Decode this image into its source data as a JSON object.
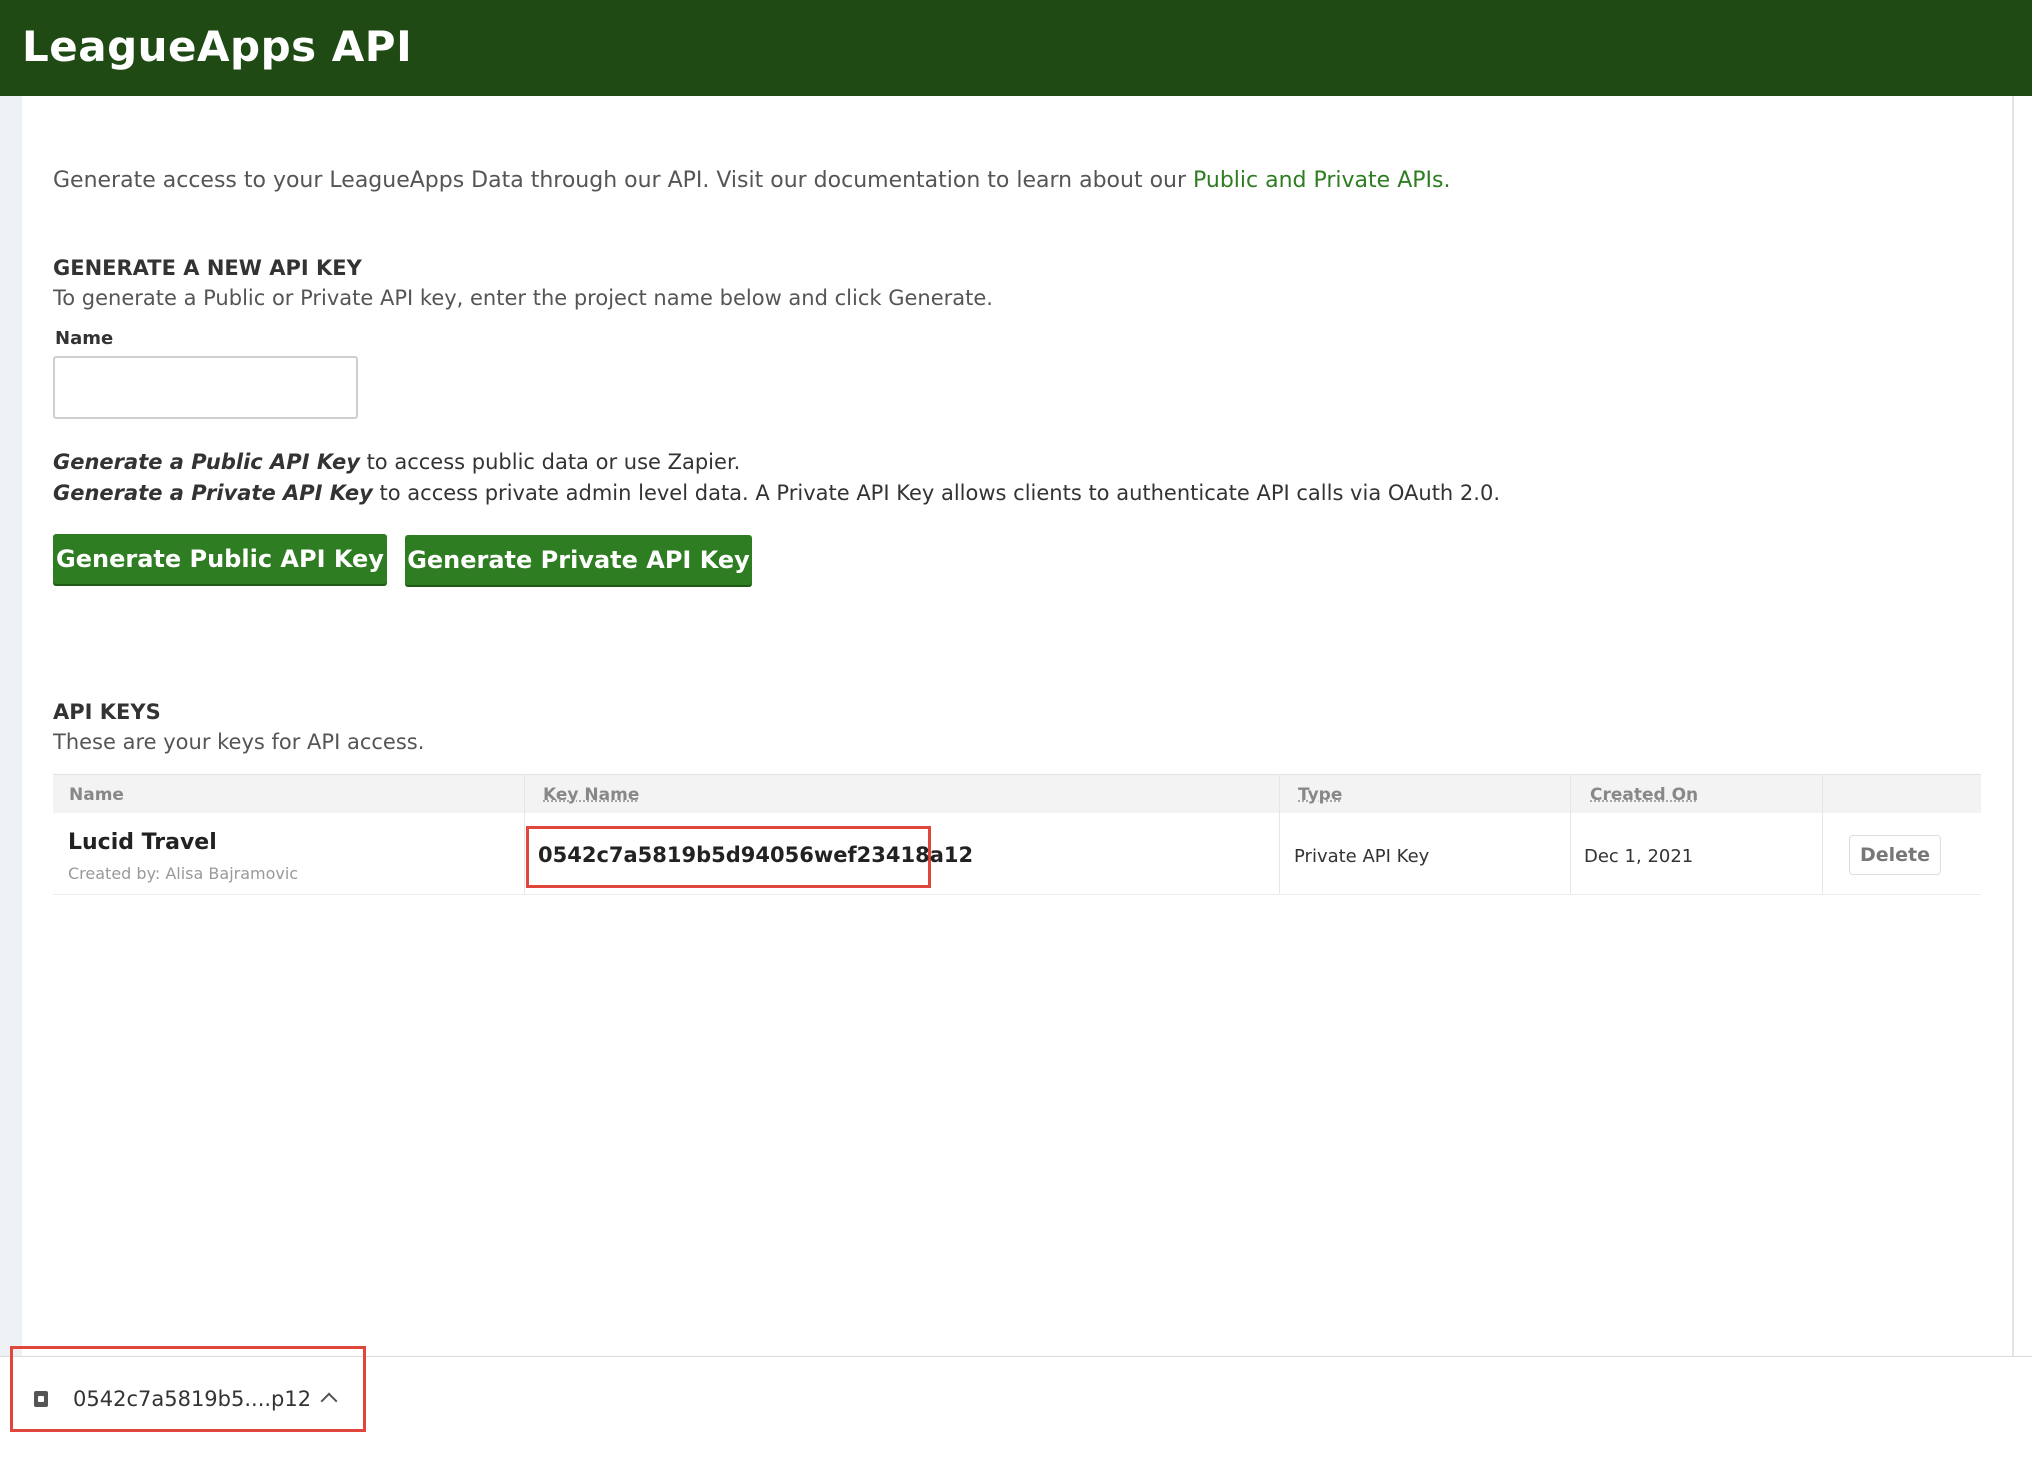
{
  "header": {
    "title": "LeagueApps API"
  },
  "intro": {
    "text": "Generate access to your LeagueApps Data through our API. Visit our documentation to learn about our ",
    "link_text": "Public and Private APIs."
  },
  "generate_section": {
    "title": "GENERATE A NEW API KEY",
    "description": "To generate a Public or Private API key, enter the project name below and click Generate.",
    "name_label": "Name",
    "name_value": "",
    "public_desc_emphasis": "Generate a Public API Key",
    "public_desc_rest": " to access public data or use Zapier.",
    "private_desc_emphasis": "Generate a Private API Key",
    "private_desc_rest": " to access private admin level data. A Private API Key allows clients to authenticate API calls via OAuth 2.0.",
    "public_button": "Generate Public API Key",
    "private_button": "Generate Private API Key"
  },
  "keys_section": {
    "title": "API KEYS",
    "description": "These are your keys for API access.",
    "columns": [
      "Name",
      "Key Name",
      "Type",
      "Created On"
    ],
    "rows": [
      {
        "name": "Lucid Travel",
        "created_by": "Created by: Alisa Bajramovic",
        "key": "0542c7a5819b5d94056wef23418a12",
        "type": "Private API Key",
        "created_on": "Dec 1, 2021",
        "action": "Delete"
      }
    ]
  },
  "download_bar": {
    "file_name": "0542c7a5819b5....p12"
  },
  "colors": {
    "header_bg": "#1f4a14",
    "button_green": "#2f7d22",
    "link_green": "#2f7d22",
    "highlight_red": "#e0463b"
  }
}
